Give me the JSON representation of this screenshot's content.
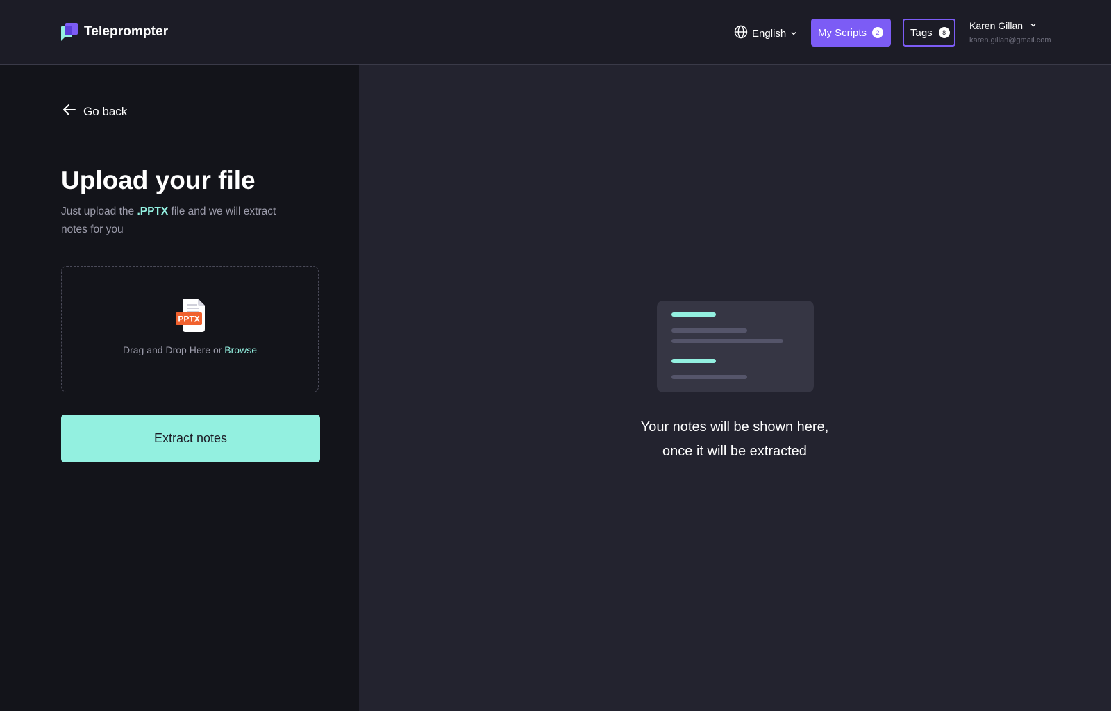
{
  "header": {
    "logo": {
      "title": "Teleprompter",
      "icon": "teleprompter-logo-icon"
    },
    "language": {
      "label": "English",
      "icon": "globe-icon"
    },
    "my_scripts": {
      "label": "My Scripts",
      "count": "2"
    },
    "tags": {
      "label": "Tags",
      "count": "8"
    },
    "user": {
      "name": "Karen Gillan",
      "email": "karen.gillan@gmail.com"
    }
  },
  "left_panel": {
    "go_back_label": "Go back",
    "title": "Upload your file",
    "subtitle_prefix": "Just upload the ",
    "subtitle_ext": ".PPTX",
    "subtitle_suffix": " file and we will extract notes for you",
    "dropzone": {
      "file_icon_label": "PPTX",
      "text": "Drag and Drop Here or ",
      "browse_label": "Browse"
    },
    "extract_button_label": "Extract notes"
  },
  "right_panel": {
    "message_line1": "Your notes will be shown here,",
    "message_line2": "once it will be extracted"
  },
  "colors": {
    "accent": "#93f0e0",
    "brand": "#7c5cf5",
    "pptx": "#f0612e",
    "header_bg": "#1c1c26",
    "left_bg": "#13141a",
    "right_bg": "#23232f"
  }
}
